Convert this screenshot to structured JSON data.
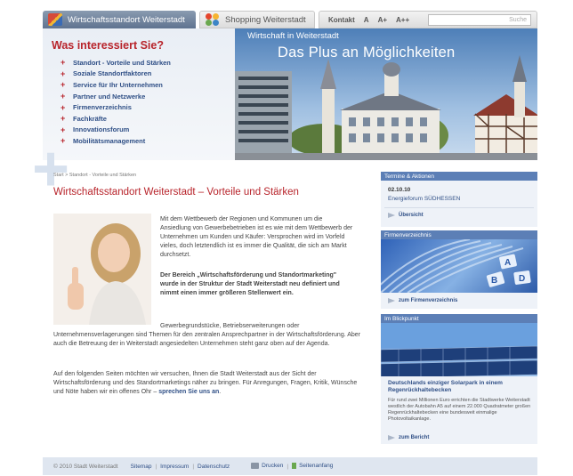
{
  "topnav": {
    "tab1_label": "Wirtschaftsstandort Weiterstadt",
    "tab2_label": "Shopping Weiterstadt",
    "kontakt_label": "Kontakt",
    "font_small": "A",
    "font_medium": "A+",
    "font_large": "A++",
    "search_placeholder": "Suche"
  },
  "sidebar": {
    "heading": "Was interessiert Sie?",
    "items": [
      {
        "label": "Standort - Vorteile und Stärken"
      },
      {
        "label": "Soziale Standortfaktoren"
      },
      {
        "label": "Service für Ihr Unternehmen"
      },
      {
        "label": "Partner und Netzwerke"
      },
      {
        "label": "Firmenverzeichnis"
      },
      {
        "label": "Fachkräfte"
      },
      {
        "label": "Innovationsforum"
      },
      {
        "label": "Mobilitätsmanagement"
      }
    ]
  },
  "hero": {
    "subtitle": "Wirtschaft in Weiterstadt",
    "title": "Das Plus an Möglichkeiten"
  },
  "breadcrumb": "Start > Standort - Vorteile und Stärken",
  "main": {
    "title": "Wirtschaftsstandort Weiterstadt – Vorteile und Stärken",
    "p1": "Mit dem Wettbewerb der Regionen und Kommunen um die Ansiedlung von Gewerbebetrieben ist es wie mit dem Wettbewerb der Unternehmen um Kunden und Käufer: Versprochen wird im Vorfeld vieles, doch letztendlich ist es immer die Qualität, die sich am Markt durchsetzt.",
    "p2": "Der Bereich „Wirtschaftsförderung und Standortmarketing\" wurde in der Struktur der Stadt Weiterstadt neu definiert und nimmt einen immer größeren Stellenwert ein.",
    "p3": "Gewerbegrundstücke, Betriebserweiterungen oder Unternehmensverlagerungen sind Themen für den zentralen Ansprechpartner in der Wirtschaftsförderung. Aber auch die Betreuung der in Weiterstadt angesiedelten Unternehmen steht ganz oben auf der Agenda.",
    "p4": "Auf den folgenden Seiten möchten wir versuchen, Ihnen die Stadt Weiterstadt aus der Sicht der Wirtschaftsförderung und des Standortmarketings näher zu bringen. Für Anregungen, Fragen, Kritik, Wünsche und Nöte haben wir ein offenes Ohr –",
    "p4_link": "sprechen Sie uns an",
    "p4_end": "."
  },
  "right": {
    "termine": {
      "header": "Termine & Aktionen",
      "date": "02.10.10",
      "event": "Energieforum SÜDHESSEN",
      "link": "Übersicht"
    },
    "firmen": {
      "header": "Firmenverzeichnis",
      "link": "zum Firmenverzeichnis"
    },
    "blick": {
      "header": "Im Blickpunkt",
      "title": "Deutschlands einziger Solarpark in einem Regenrückhaltebecken",
      "text": "Für rund zwei Millionen Euro errichten die Stadtwerke Weiterstadt westlich der Autobahn A5 auf einem 22.000 Quadratmeter großen Regenrückhaltebecken eine bundesweit einmalige Photovoltaikanlage.",
      "link": "zum Bericht"
    }
  },
  "footer": {
    "copyright": "© 2010 Stadt Weiterstadt",
    "sitemap": "Sitemap",
    "impressum": "Impressum",
    "datenschutz": "Datenschutz",
    "drucken": "Drucken",
    "seitenanfang": "Seitenanfang"
  },
  "colors": {
    "accent_red": "#b8242b",
    "link_blue": "#2f4f86",
    "box_header": "#5c7fb6"
  }
}
